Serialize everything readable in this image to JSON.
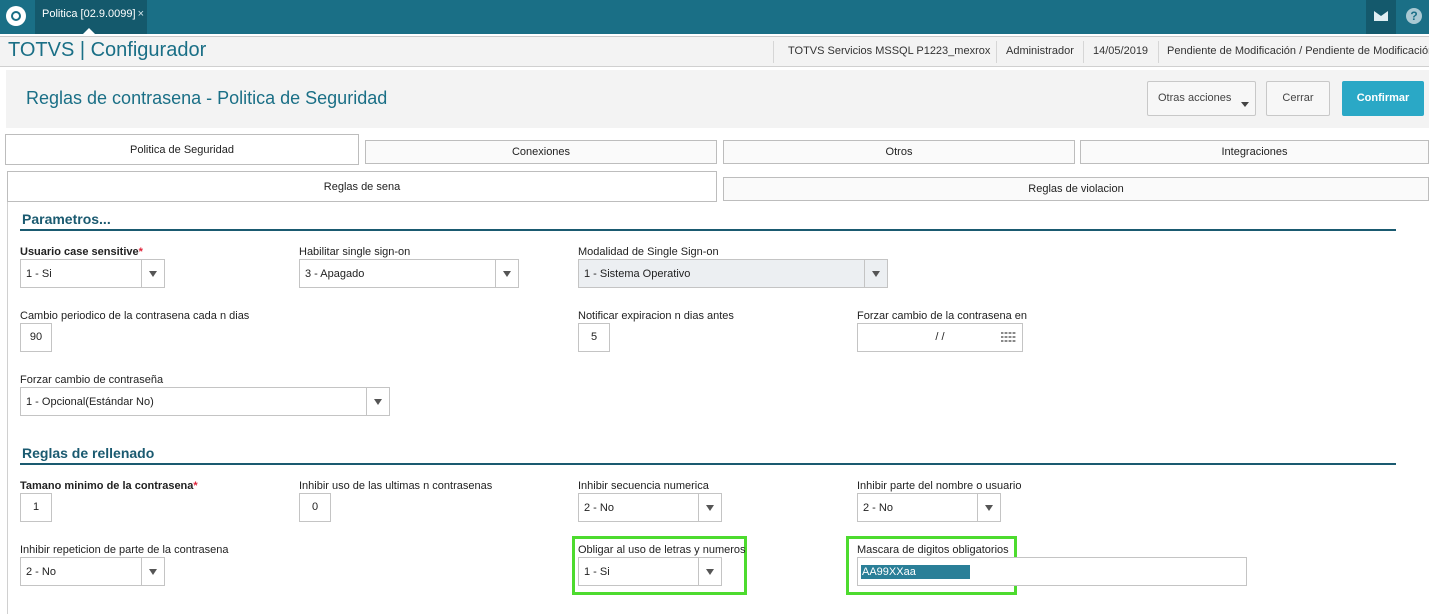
{
  "topbar": {
    "tab_label": "Politica [02.9.0099]",
    "tab_close": "×",
    "help_glyph": "?"
  },
  "appbar": {
    "title": "TOTVS | Configurador",
    "environment": "TOTVS Servicios MSSQL P1223_mexrox",
    "user": "Administrador",
    "date": "14/05/2019",
    "status": "Pendiente de Modificación / Pendiente de Modificación"
  },
  "header": {
    "title": "Reglas de contrasena - Politica de Seguridad",
    "otras_acciones": "Otras acciones",
    "cerrar": "Cerrar",
    "confirmar": "Confirmar"
  },
  "tabs": [
    "Politica de Seguridad",
    "Conexiones",
    "Otros",
    "Integraciones"
  ],
  "subtabs": [
    "Reglas de sena",
    "Reglas de violacion"
  ],
  "sections": {
    "parametros": "Parametros...",
    "rellenado": "Reglas de rellenado"
  },
  "fields": {
    "usuario_case": {
      "label": "Usuario case sensitive",
      "required": "*",
      "value": "1 - Si"
    },
    "single_sign_on": {
      "label": "Habilitar single sign-on",
      "value": "3 - Apagado"
    },
    "modalidad_sso": {
      "label": "Modalidad de Single Sign-on",
      "value": "1 - Sistema Operativo"
    },
    "cambio_periodico": {
      "label": "Cambio periodico de la contrasena cada n dias",
      "value": "90"
    },
    "notificar_expiracion": {
      "label": "Notificar expiracion n dias antes",
      "value": "5"
    },
    "forzar_cambio_en": {
      "label": "Forzar cambio de la contrasena en",
      "value": "/ /"
    },
    "forzar_cambio": {
      "label": "Forzar cambio de contraseña",
      "value": "1 - Opcional(Estándar No)"
    },
    "tamano_minimo": {
      "label": "Tamano minimo de la contrasena",
      "required": "*",
      "value": "1"
    },
    "inhibir_ultimas": {
      "label": "Inhibir uso de las ultimas n contrasenas",
      "value": "0"
    },
    "inhibir_secuencia": {
      "label": "Inhibir secuencia numerica",
      "value": "2 - No"
    },
    "inhibir_nombre": {
      "label": "Inhibir parte del nombre o usuario",
      "value": "2 - No"
    },
    "inhibir_repeticion": {
      "label": "Inhibir repeticion de parte de la contrasena",
      "value": "2 - No"
    },
    "obligar_letras": {
      "label": "Obligar al uso de letras y numeros",
      "value": "1 - Si"
    },
    "mascara_digitos": {
      "label": "Mascara de digitos obligatorios",
      "value": "AA99XXaa"
    }
  },
  "colors": {
    "brand": "#1a6f86",
    "confirm": "#2aa8c6",
    "highlight": "#4ddb2e",
    "required": "#e0233a"
  },
  "icons": [
    "totvs-logo-icon",
    "close-icon",
    "mail-icon",
    "help-icon",
    "chevron-down-icon",
    "calendar-icon"
  ]
}
